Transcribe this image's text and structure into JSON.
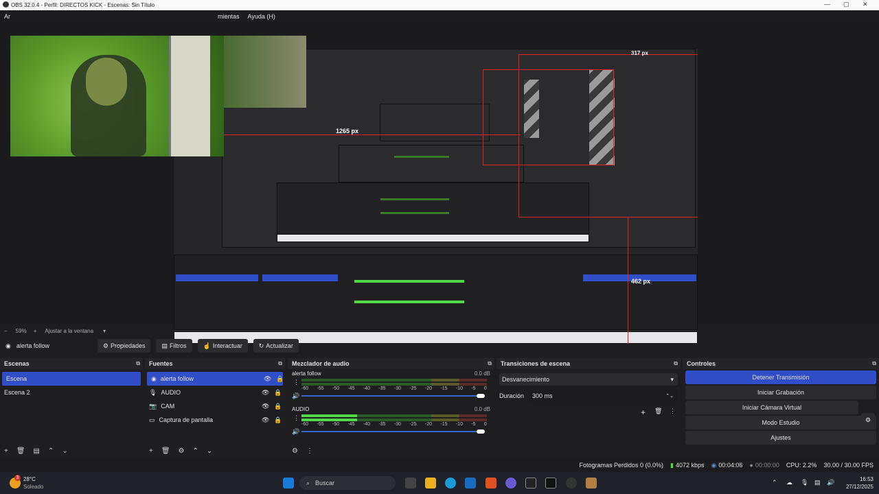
{
  "window": {
    "title": "OBS 32.0.4 - Perfil: DIRECTOS KICK - Escenas: Sin Título"
  },
  "menu": [
    "Ar",
    "mientas",
    "Ayuda (H)"
  ],
  "preview": {
    "labels": {
      "px_a": "1265 px",
      "px_b": "462 px",
      "px_c": "317 px"
    }
  },
  "preview_footer": {
    "zoom": "59%",
    "fit_label": "Ajustar a la ventana"
  },
  "source_toolbar": {
    "current_source": "alerta follow",
    "properties": "Propiedades",
    "filters": "Filtros",
    "interact": "Interactuar",
    "refresh": "Actualizar"
  },
  "scenes": {
    "title": "Escenas",
    "items": [
      "Escena",
      "Escena 2"
    ]
  },
  "sources": {
    "title": "Fuentes",
    "items": [
      {
        "label": "alerta follow",
        "icon": "browser-icon"
      },
      {
        "label": "AUDIO",
        "icon": "mic-icon"
      },
      {
        "label": "CAM",
        "icon": "camera-icon"
      },
      {
        "label": "Captura de pantalla",
        "icon": "monitor-icon"
      }
    ]
  },
  "mixer": {
    "title": "Mezclador de audio",
    "channels": [
      {
        "name": "alerta follow",
        "db": "0.0 dB",
        "level": 0
      },
      {
        "name": "AUDIO",
        "db": "0.0 dB",
        "level": 0.3
      }
    ],
    "ticks": [
      "-60",
      "-55",
      "-50",
      "-45",
      "-40",
      "-35",
      "-30",
      "-25",
      "-20",
      "-15",
      "-10",
      "-5",
      "0"
    ]
  },
  "transitions": {
    "title": "Transiciones de escena",
    "selected": "Desvanecimiento",
    "duration_label": "Duración",
    "duration_value": "300 ms"
  },
  "controls": {
    "title": "Controles",
    "stop_stream": "Detener Transmisión",
    "start_recording": "Iniciar Grabación",
    "virtual_cam": "Iniciar Cámara Virtual",
    "studio_mode": "Modo Estudio",
    "settings": "Ajustes"
  },
  "status": {
    "dropped": "Fotogramas Perdidos 0 (0.0%)",
    "bitrate": "4072 kbps",
    "stream_time": "00:04:06",
    "rec_time": "00:00:00",
    "cpu": "CPU: 2.2%",
    "fps": "30.00 / 30.00 FPS"
  },
  "taskbar": {
    "weather_temp": "28°C",
    "weather_desc": "Soleado",
    "badge": "3",
    "search": "Buscar",
    "time": "16:53",
    "date": "27/12/2025"
  },
  "colors": {
    "accent": "#2f4ec7",
    "selection_red": "#e02020",
    "meter_green": "#52d94a"
  }
}
